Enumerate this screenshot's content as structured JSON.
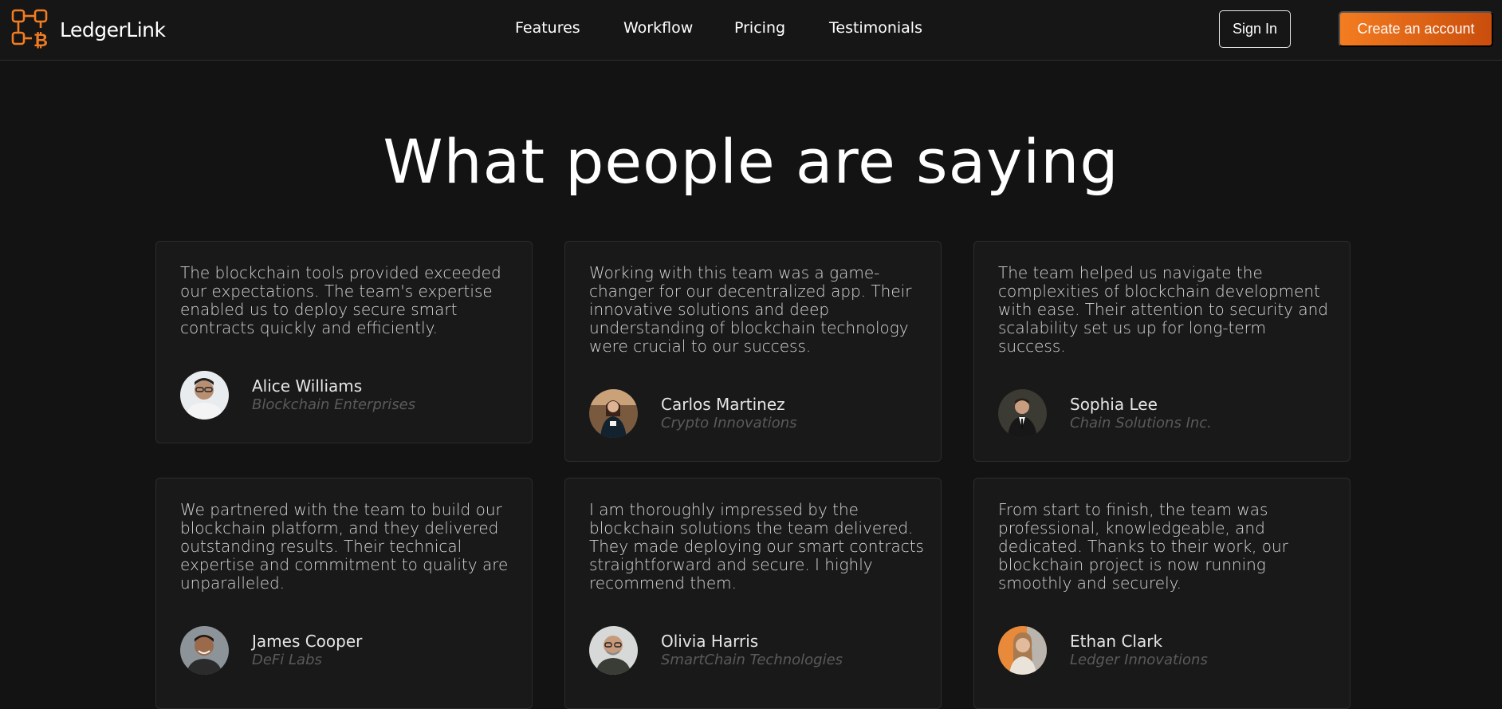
{
  "brand": {
    "name": "LedgerLink",
    "logo_icon": "blockchain-bitcoin-logo-icon",
    "accent": "#f47c20"
  },
  "nav": {
    "links": [
      "Features",
      "Workflow",
      "Pricing",
      "Testimonials"
    ],
    "sign_in": "Sign In",
    "create_account": "Create an account"
  },
  "testimonials": {
    "title": "What people are saying",
    "cards": [
      {
        "quote": "The blockchain tools provided exceeded our expectations. The team's expertise enabled us to deploy secure smart contracts quickly and efficiently.",
        "name": "Alice Williams",
        "company": "Blockchain Enterprises"
      },
      {
        "quote": "Working with this team was a game-changer for our decentralized app. Their innovative solutions and deep understanding of blockchain technology were crucial to our success.",
        "name": "Carlos Martinez",
        "company": "Crypto Innovations"
      },
      {
        "quote": "The team helped us navigate the complexities of blockchain development with ease. Their attention to security and scalability set us up for long-term success.",
        "name": "Sophia Lee",
        "company": "Chain Solutions Inc."
      },
      {
        "quote": "We partnered with the team to build our blockchain platform, and they delivered outstanding results. Their technical expertise and commitment to quality are unparalleled.",
        "name": "James Cooper",
        "company": "DeFi Labs"
      },
      {
        "quote": "I am thoroughly impressed by the blockchain solutions the team delivered. They made deploying our smart contracts straightforward and secure. I highly recommend them.",
        "name": "Olivia Harris",
        "company": "SmartChain Technologies"
      },
      {
        "quote": "From start to finish, the team was professional, knowledgeable, and dedicated. Thanks to their work, our blockchain project is now running smoothly and securely.",
        "name": "Ethan Clark",
        "company": "Ledger Innovations"
      }
    ]
  }
}
